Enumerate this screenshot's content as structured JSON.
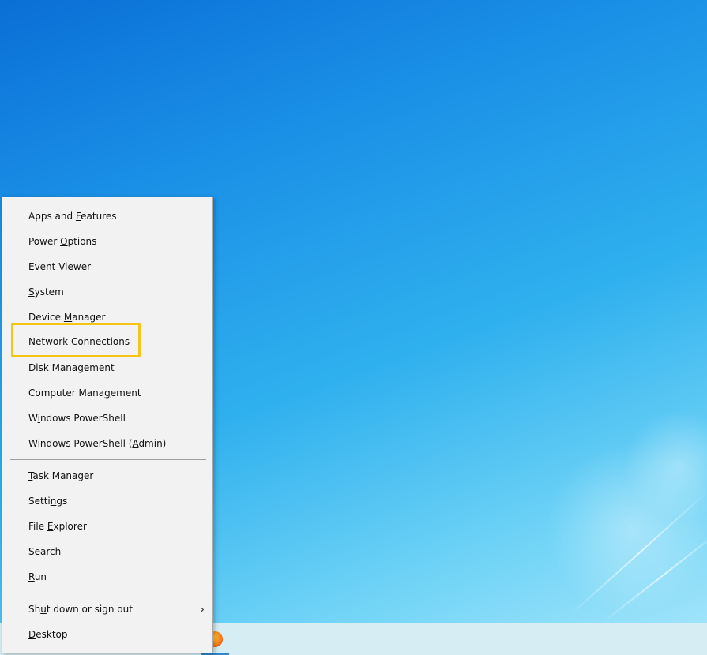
{
  "menu": {
    "items": [
      {
        "id": "apps-and-features",
        "pre": "Apps and ",
        "key": "F",
        "post": "eatures"
      },
      {
        "id": "power-options",
        "pre": "Power ",
        "key": "O",
        "post": "ptions"
      },
      {
        "id": "event-viewer",
        "pre": "Event ",
        "key": "V",
        "post": "iewer"
      },
      {
        "id": "system",
        "pre": "",
        "key": "S",
        "post": "ystem"
      },
      {
        "id": "device-manager",
        "pre": "Device ",
        "key": "M",
        "post": "anager"
      },
      {
        "id": "network-connections",
        "pre": "Net",
        "key": "w",
        "post": "ork Connections"
      },
      {
        "id": "disk-management",
        "pre": "Dis",
        "key": "k",
        "post": " Management"
      },
      {
        "id": "computer-management",
        "pre": "Computer Mana",
        "key": "g",
        "post": "ement"
      },
      {
        "id": "windows-powershell",
        "pre": "W",
        "key": "i",
        "post": "ndows PowerShell"
      },
      {
        "id": "windows-powershell-admin",
        "pre": "Windows PowerShell (",
        "key": "A",
        "post": "dmin)"
      },
      {
        "id": "task-manager",
        "pre": "",
        "key": "T",
        "post": "ask Manager"
      },
      {
        "id": "settings",
        "pre": "Setti",
        "key": "n",
        "post": "gs"
      },
      {
        "id": "file-explorer",
        "pre": "File ",
        "key": "E",
        "post": "xplorer"
      },
      {
        "id": "search",
        "pre": "",
        "key": "S",
        "post": "earch"
      },
      {
        "id": "run",
        "pre": "",
        "key": "R",
        "post": "un"
      },
      {
        "id": "shut-down-or-sign-out",
        "pre": "Sh",
        "key": "u",
        "post": "t down or sign out"
      },
      {
        "id": "desktop",
        "pre": "",
        "key": "D",
        "post": "esktop"
      }
    ],
    "submenu_arrow": "›"
  }
}
